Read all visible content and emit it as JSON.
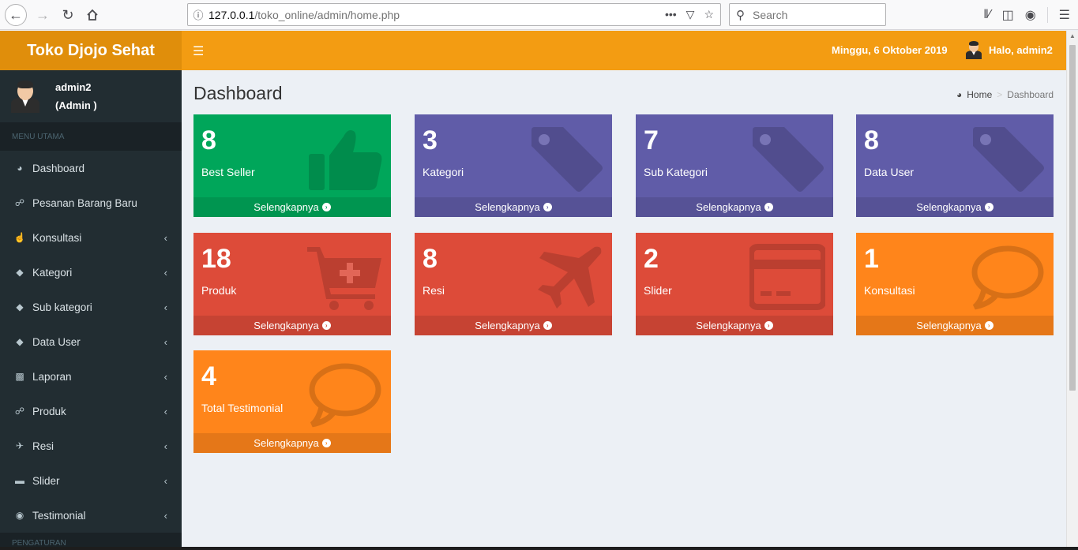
{
  "browser": {
    "url_host": "127.0.0.1",
    "url_path": "/toko_online/admin/home.php",
    "search_placeholder": "Search"
  },
  "header": {
    "brand": "Toko Djojo Sehat",
    "date": "Minggu, 6 Oktober 2019",
    "greeting": "Halo, admin2"
  },
  "sidebar": {
    "user_name": "admin2",
    "user_role": "(Admin )",
    "menu_header": "MENU UTAMA",
    "bottom_header": "PENGATURAN",
    "items": [
      {
        "label": "Dashboard",
        "icon": "dashboard-icon",
        "has_arrow": false
      },
      {
        "label": "Pesanan Barang Baru",
        "icon": "cart-icon",
        "has_arrow": false
      },
      {
        "label": "Konsultasi",
        "icon": "thumbs-up-icon",
        "has_arrow": true
      },
      {
        "label": "Kategori",
        "icon": "tag-icon",
        "has_arrow": true
      },
      {
        "label": "Sub kategori",
        "icon": "tag-icon",
        "has_arrow": true
      },
      {
        "label": "Data User",
        "icon": "tag-icon",
        "has_arrow": true
      },
      {
        "label": "Laporan",
        "icon": "truck-icon",
        "has_arrow": true
      },
      {
        "label": "Produk",
        "icon": "cart-icon",
        "has_arrow": true
      },
      {
        "label": "Resi",
        "icon": "plane-icon",
        "has_arrow": true
      },
      {
        "label": "Slider",
        "icon": "credit-card-icon",
        "has_arrow": true
      },
      {
        "label": "Testimonial",
        "icon": "comments-icon",
        "has_arrow": true
      }
    ]
  },
  "content": {
    "title": "Dashboard",
    "breadcrumb_home": "Home",
    "breadcrumb_current": "Dashboard",
    "more_label": "Selengkapnya",
    "boxes": [
      {
        "value": "8",
        "label": "Best Seller",
        "color": "#00a65a",
        "icon": "thumbs-up-icon"
      },
      {
        "value": "3",
        "label": "Kategori",
        "color": "#605ca8",
        "icon": "tag-icon"
      },
      {
        "value": "7",
        "label": "Sub Kategori",
        "color": "#605ca8",
        "icon": "tag-icon"
      },
      {
        "value": "8",
        "label": "Data User",
        "color": "#605ca8",
        "icon": "tag-icon"
      },
      {
        "value": "18",
        "label": "Produk",
        "color": "#dd4b39",
        "icon": "cart-plus-icon"
      },
      {
        "value": "8",
        "label": "Resi",
        "color": "#dd4b39",
        "icon": "plane-icon"
      },
      {
        "value": "2",
        "label": "Slider",
        "color": "#dd4b39",
        "icon": "credit-card-icon"
      },
      {
        "value": "1",
        "label": "Konsultasi",
        "color": "#ff851b",
        "icon": "comment-icon"
      },
      {
        "value": "4",
        "label": "Total Testimonial",
        "color": "#ff851b",
        "icon": "comment-icon"
      }
    ]
  }
}
